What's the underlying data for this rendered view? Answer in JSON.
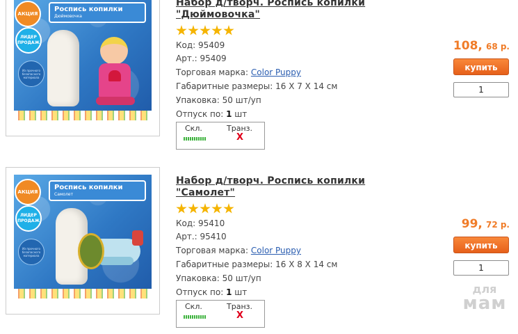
{
  "products": [
    {
      "title_line1": "Набор д/творч. Роспись копилки",
      "title_line2": "\"Дюймовочка\"",
      "image": {
        "box_title": "Роспись копилки",
        "box_subtitle": "Дюймовочка",
        "promo_badge": "АКЦИЯ",
        "leader_badge": "ЛИДЕР ПРОДАЖ",
        "material_badge": "Из прочного безопасного материала"
      },
      "rating_stars": 5,
      "code_label": "Код:",
      "code": "95409",
      "article_label": "Арт.:",
      "article": "95409",
      "brand_label": "Торговая марка:",
      "brand": "Color Puppy",
      "dims_label": "Габаритные размеры:",
      "dims": "16 X 7 X 14 см",
      "pack_label": "Упаковка:",
      "pack": "50 шт/уп",
      "release_label": "Отпуск по:",
      "release_qty": "1",
      "release_unit": "шт",
      "stock": {
        "warehouse_label": "Скл.",
        "transit_label": "Транз.",
        "transit_value": "X"
      },
      "price_rub": "108,",
      "price_kop": "68 р.",
      "buy_label": "купить",
      "quantity": "1"
    },
    {
      "title_line1": "Набор д/творч. Роспись копилки",
      "title_line2": "\"Самолет\"",
      "image": {
        "box_title": "Роспись копилки",
        "box_subtitle": "Самолет",
        "promo_badge": "АКЦИЯ",
        "leader_badge": "ЛИДЕР ПРОДАЖ",
        "material_badge": "Из прочного безопасного материала"
      },
      "rating_stars": 5,
      "code_label": "Код:",
      "code": "95410",
      "article_label": "Арт.:",
      "article": "95410",
      "brand_label": "Торговая марка:",
      "brand": "Color Puppy",
      "dims_label": "Габаритные размеры:",
      "dims": "16 X 8 X 14 см",
      "pack_label": "Упаковка:",
      "pack": "50 шт/уп",
      "release_label": "Отпуск по:",
      "release_qty": "1",
      "release_unit": "шт",
      "stock": {
        "warehouse_label": "Скл.",
        "transit_label": "Транз.",
        "transit_value": "X"
      },
      "price_rub": "99,",
      "price_kop": "72 р.",
      "buy_label": "купить",
      "quantity": "1"
    }
  ],
  "watermark": {
    "line1": "для",
    "line2": "мам"
  },
  "colors": {
    "accent": "#f07c28",
    "button": "#e6601a",
    "link": "#2a5db0",
    "stock_ok": "#3fb33f",
    "stock_none": "#e0001a",
    "star": "#f5b400"
  }
}
